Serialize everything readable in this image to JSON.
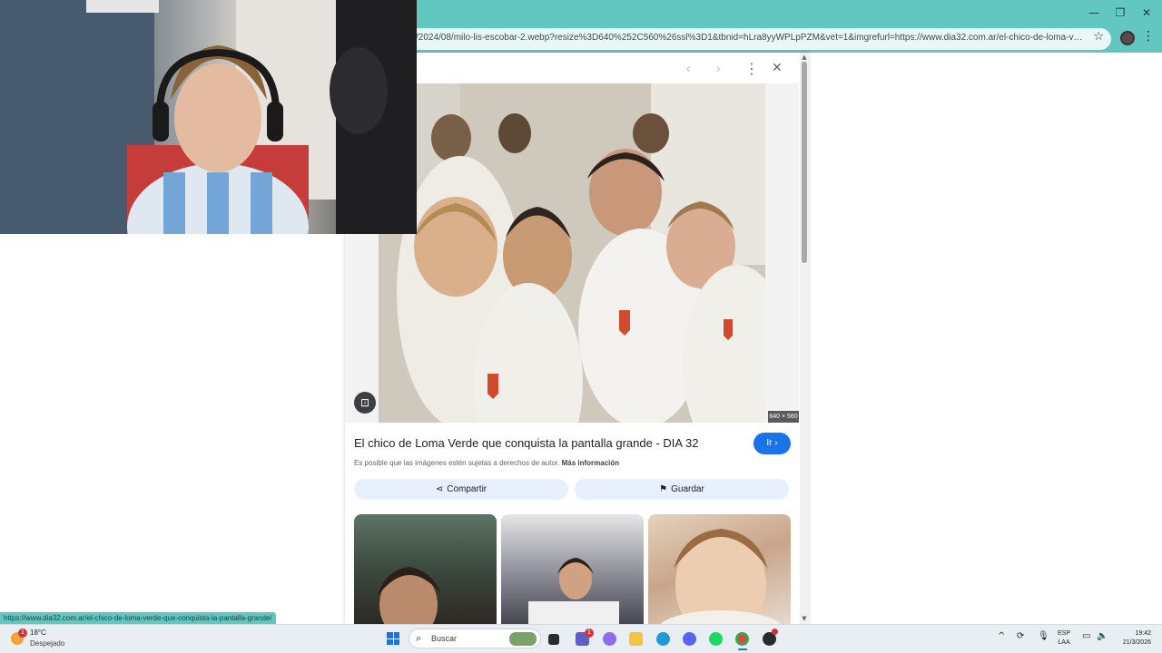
{
  "window": {
    "minimize_glyph": "—",
    "maximize_glyph": "❐",
    "close_glyph": "✕"
  },
  "browser": {
    "url": "/2024/08/milo-lis-escobar-2.webp?resize%3D640%252C560%26ssl%3D1&tbnid=hLra8yyWPLpPZM&vet=1&imgrefurl=https://www.dia32.com.ar/el-chico-de-loma-verde-que-c...",
    "bookmark_icon": "star-outline-icon",
    "menu_icon": "three-dots-vertical-icon"
  },
  "viewer": {
    "prev_glyph": "‹",
    "next_glyph": "›",
    "more_glyph": "⋮",
    "close_glyph": "✕",
    "lens_glyph": "⊡",
    "image_dimensions": "640 × 560",
    "title": "El chico de Loma Verde que conquista la pantalla grande - DIA 32",
    "go_label": "Ir ›",
    "rights_text": "Es posible que las imágenes estén sujetas a derechos de autor.",
    "rights_link": "Más información",
    "share_glyph": "⋖",
    "share_label": "Compartir",
    "save_glyph": "⚑",
    "save_label": "Guardar",
    "related_count": 3
  },
  "status_bar": {
    "hover_url": "https://www.dia32.com.ar/el-chico-de-loma-verde-que-conquista-la-pantalla-grande/"
  },
  "taskbar": {
    "weather_temp": "18°C",
    "weather_condition": "Despejado",
    "weather_badge": "1",
    "search_glyph": "⌕",
    "search_label": "Buscar",
    "teams_badge": "1",
    "tray_chevron": "^",
    "language_top": "ESP",
    "language_bottom": "LAA",
    "time": "19:42",
    "date": "21/3/2026"
  },
  "colors": {
    "chrome_accent": "#62c6c1",
    "link_blue": "#1a73e8",
    "pill_bg": "#e8f0fe",
    "taskbar_bg": "#e9eef2"
  }
}
